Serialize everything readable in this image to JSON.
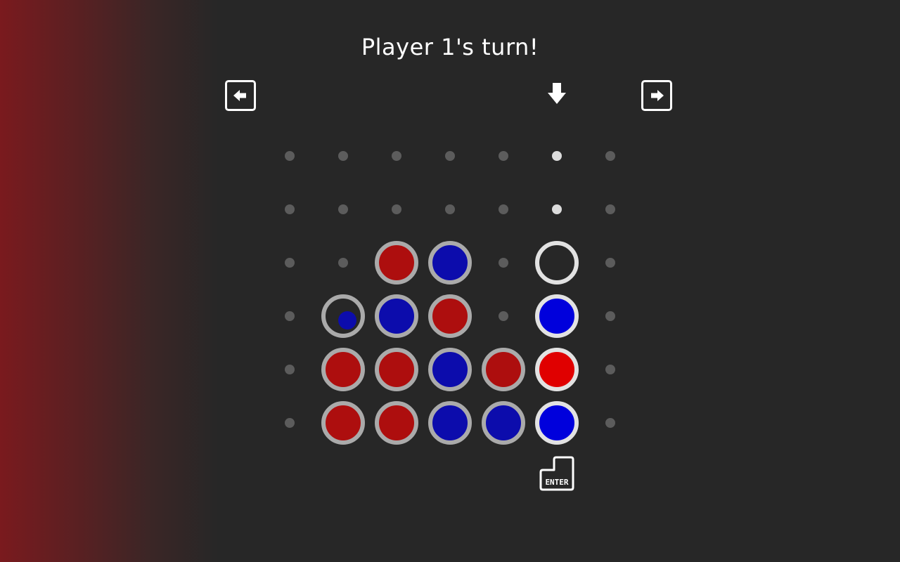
{
  "status": {
    "title": "Player 1's turn!"
  },
  "controls": {
    "left_key_icon": "arrow-left-icon",
    "right_key_icon": "arrow-right-icon",
    "drop_indicator_icon": "arrow-down-icon",
    "enter_key_icon": "enter-key-icon",
    "enter_label": "ENTER"
  },
  "colors": {
    "background": "#272727",
    "player1_glow": "#7a1a1e",
    "red_disc": "#ad0e0e",
    "blue_disc": "#0c0cac",
    "red_disc_selected": "#e00000",
    "blue_disc_selected": "#0000dc",
    "empty_slot": "#5c5c5c",
    "selected_slot": "#dcdcdc"
  },
  "board": {
    "columns": 7,
    "rows": 6,
    "selected_column": 5,
    "grid": [
      [
        "",
        "",
        "",
        "",
        "",
        "",
        ""
      ],
      [
        "",
        "",
        "",
        "",
        "",
        "",
        ""
      ],
      [
        "",
        "",
        "red",
        "blue",
        "",
        "preview",
        ""
      ],
      [
        "",
        "blue-ring",
        "blue",
        "red",
        "",
        "blue",
        ""
      ],
      [
        "",
        "red",
        "red",
        "blue",
        "red",
        "red",
        ""
      ],
      [
        "",
        "red",
        "red",
        "blue",
        "blue",
        "blue",
        ""
      ]
    ]
  }
}
